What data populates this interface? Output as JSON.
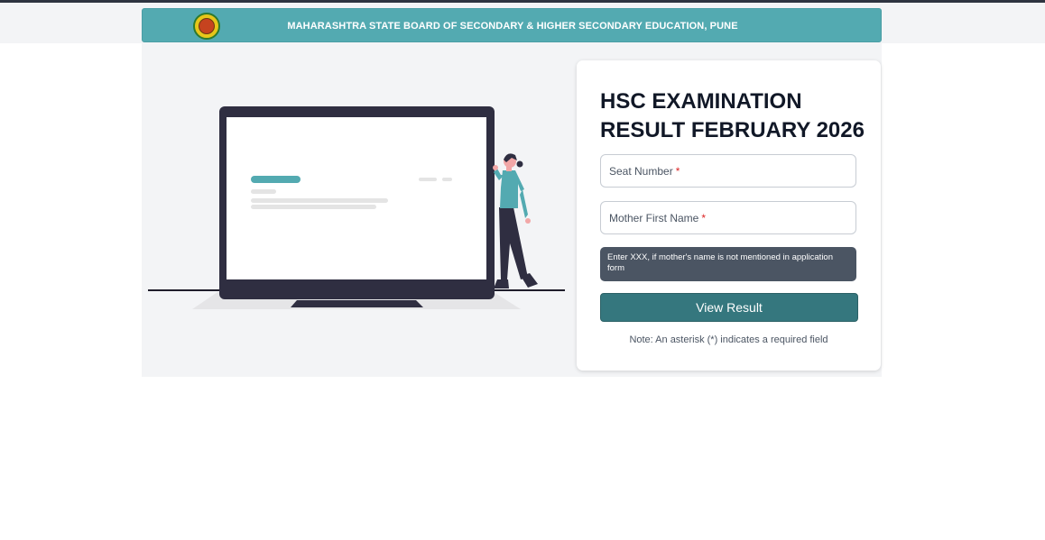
{
  "header": {
    "title": "MAHARASHTRA STATE BOARD OF SECONDARY & HIGHER SECONDARY EDUCATION, PUNE",
    "logo_icon": "board-seal-icon"
  },
  "form": {
    "title": "HSC EXAMINATION RESULT FEBRUARY 2026",
    "seat_number_label": "Seat Number",
    "mother_name_label": "Mother First Name",
    "required_marker": "*",
    "hint": "Enter XXX, if mother's name is not mentioned in application form",
    "submit_label": "View Result",
    "note": "Note: An asterisk (*) indicates a required field"
  },
  "colors": {
    "header_bg": "#53aab1",
    "button_bg": "#35777e",
    "hint_bg": "#4b5563",
    "required": "#dc2626"
  }
}
